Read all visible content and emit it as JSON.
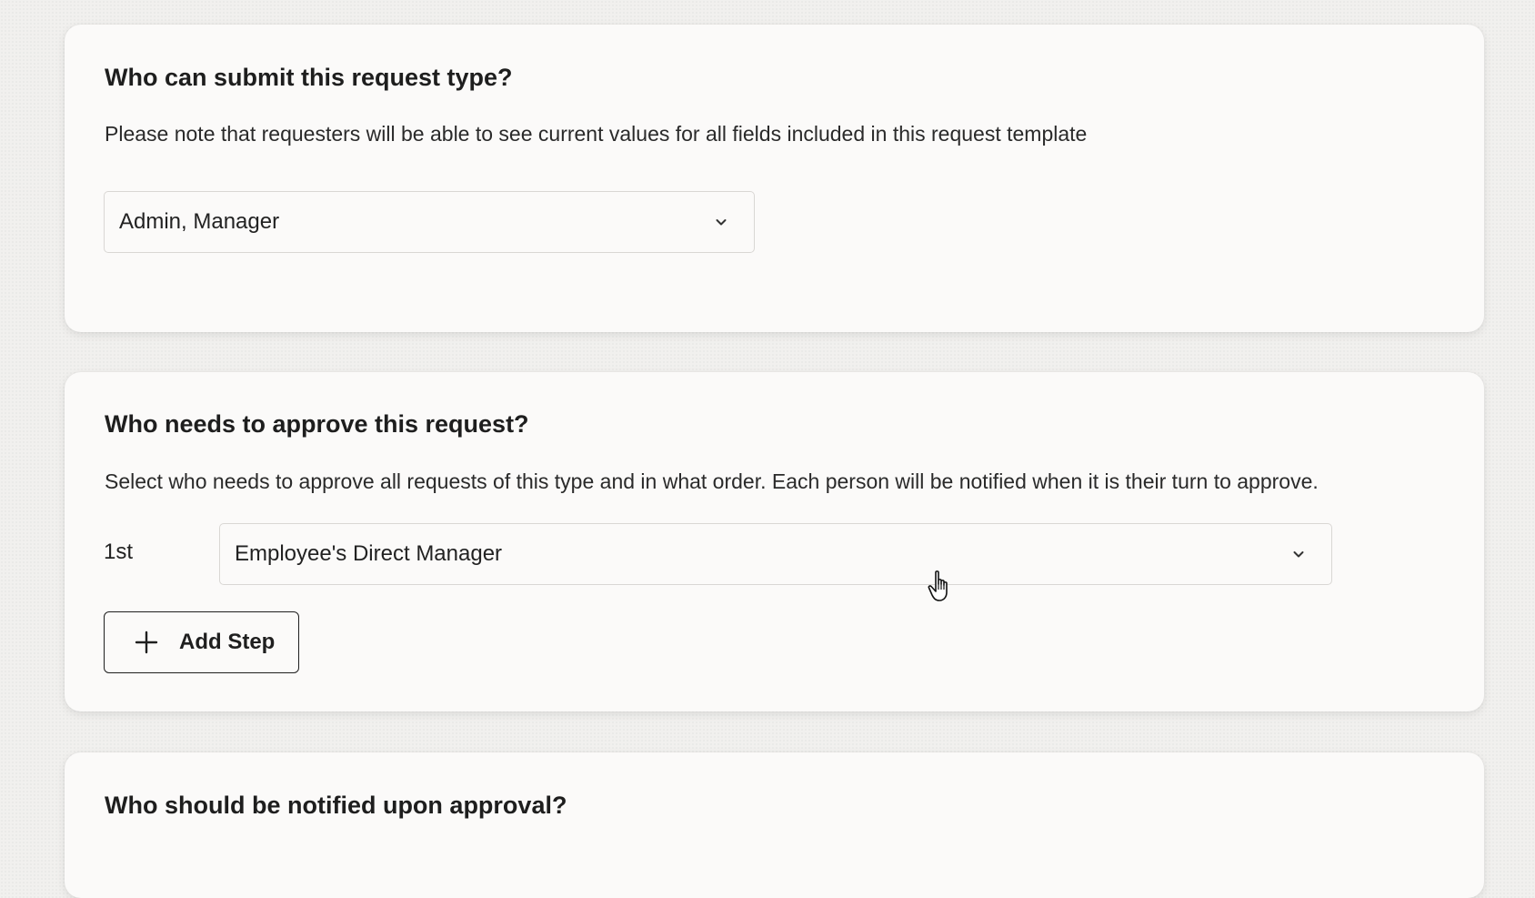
{
  "sections": {
    "submit": {
      "title": "Who can submit this request type?",
      "description": "Please note that requesters will be able to see current values for all fields included in this request template",
      "select_value": "Admin, Manager"
    },
    "approve": {
      "title": "Who needs to approve this request?",
      "description": "Select who needs to approve all requests of this type and in what order. Each person will be notified when it is their turn to approve.",
      "steps": [
        {
          "label": "1st",
          "value": "Employee's Direct Manager"
        }
      ],
      "add_step_label": "Add Step"
    },
    "notify": {
      "title": "Who should be notified upon approval?"
    }
  },
  "icons": {
    "chevron": "chevron-down-icon",
    "plus": "plus-icon",
    "cursor": "hand-pointer-cursor"
  }
}
